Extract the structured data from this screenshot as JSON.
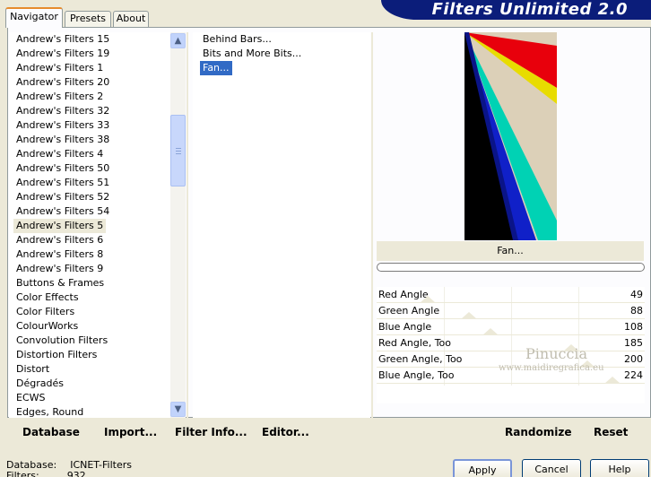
{
  "tabs": [
    {
      "label": "Navigator",
      "active": true
    },
    {
      "label": "Presets",
      "active": false
    },
    {
      "label": "About",
      "active": false
    }
  ],
  "banner_title": "Filters Unlimited 2.0",
  "categories": [
    "Andrew's Filters 15",
    "Andrew's Filters 19",
    "Andrew's Filters 1",
    "Andrew's Filters 20",
    "Andrew's Filters 2",
    "Andrew's Filters 32",
    "Andrew's Filters 33",
    "Andrew's Filters 38",
    "Andrew's Filters 4",
    "Andrew's Filters 50",
    "Andrew's Filters 51",
    "Andrew's Filters 52",
    "Andrew's Filters 54",
    "Andrew's Filters 5",
    "Andrew's Filters 6",
    "Andrew's Filters 8",
    "Andrew's Filters 9",
    "Buttons & Frames",
    "Color Effects",
    "Color Filters",
    "ColourWorks",
    "Convolution Filters",
    "Distortion Filters",
    "Distort",
    "Dégradés",
    "ECWS",
    "Edges, Round"
  ],
  "selected_category": "Andrew's Filters 5",
  "scroll_icons": {
    "up": "chevron-up-icon",
    "down": "chevron-down-icon"
  },
  "filters": [
    "Behind Bars...",
    "Bits and More Bits...",
    "Fan..."
  ],
  "selected_filter": "Fan...",
  "preview_filter_name": "Fan...",
  "controls": [
    {
      "label": "Red Angle",
      "value": "49"
    },
    {
      "label": "Green Angle",
      "value": "88"
    },
    {
      "label": "Blue Angle",
      "value": "108"
    },
    {
      "label": "Red Angle, Too",
      "value": "185"
    },
    {
      "label": "Green Angle, Too",
      "value": "200"
    },
    {
      "label": "Blue Angle, Too",
      "value": "224"
    }
  ],
  "watermark": {
    "line1": "Pinuccia",
    "line2": "www.maidiregrafica.eu"
  },
  "left_buttons": {
    "database": "Database",
    "import": "Import...",
    "filter_info": "Filter Info...",
    "editor": "Editor..."
  },
  "right_buttons": {
    "randomize": "Randomize",
    "reset": "Reset"
  },
  "status": {
    "database_label": "Database:",
    "database_value": "ICNET-Filters",
    "filters_label": "Filters:",
    "filters_value": "932"
  },
  "dialog_buttons": {
    "apply": "Apply",
    "cancel": "Cancel",
    "help": "Help"
  },
  "colors": {
    "banner": "#0b1d7a",
    "selection": "#316ac5",
    "fan_red": "#e8000c",
    "fan_yellow": "#e8dc00",
    "fan_cyan": "#00d2b4",
    "fan_blue": "#1020c8",
    "fan_beige": "#dcd0b8"
  }
}
